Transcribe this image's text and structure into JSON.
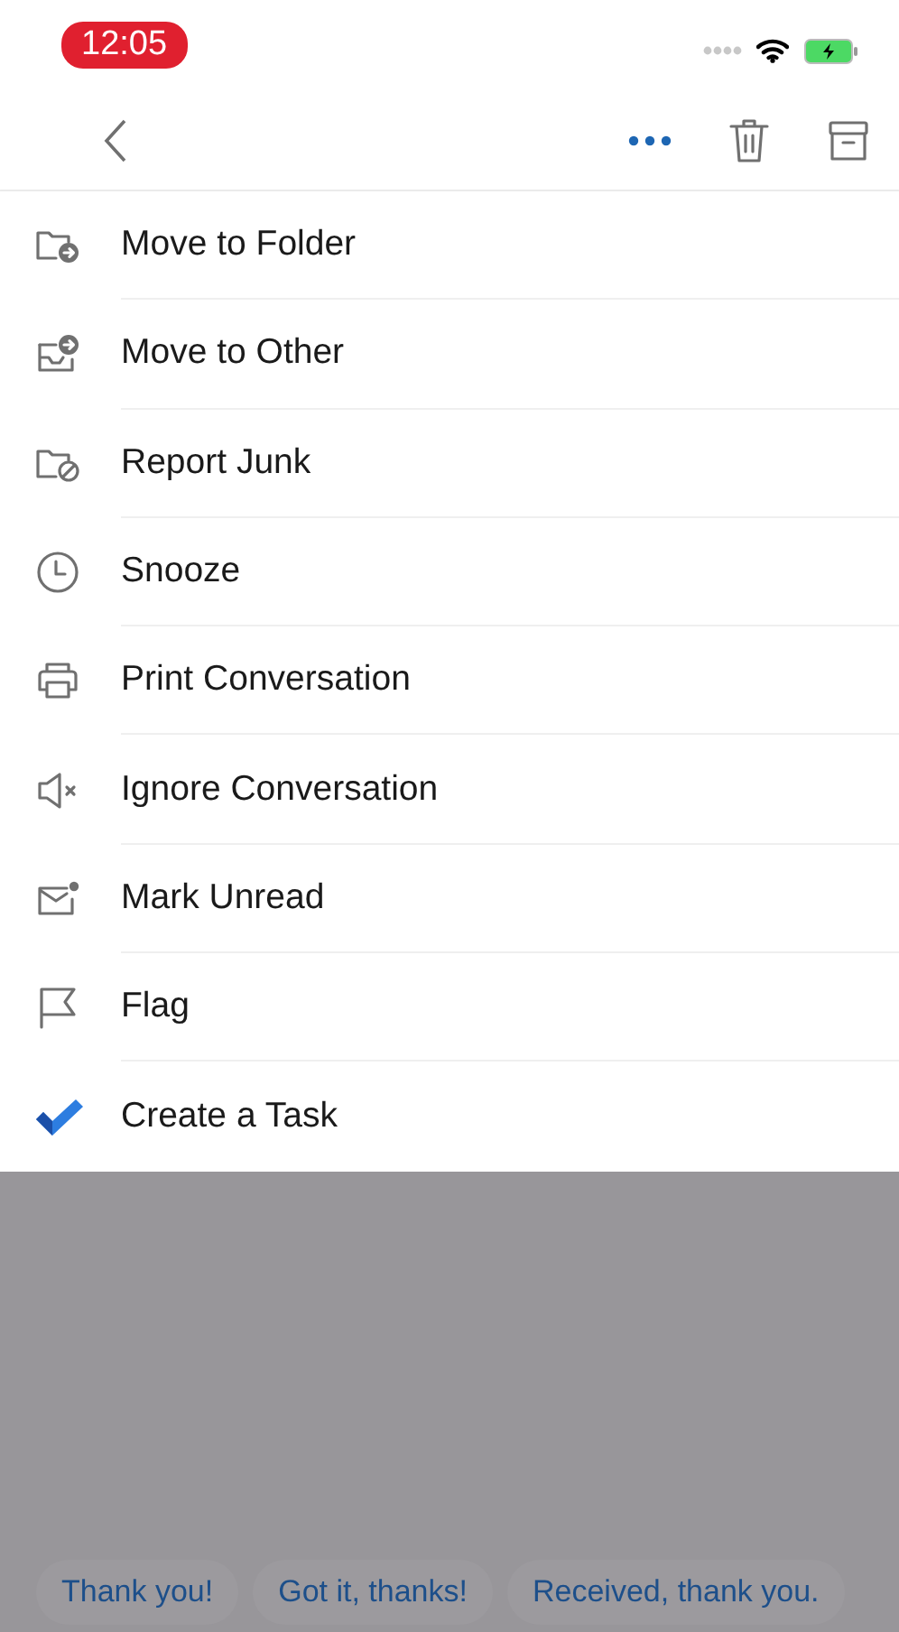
{
  "status_bar": {
    "time": "12:05"
  },
  "menu": {
    "items": [
      {
        "label": "Move to Folder"
      },
      {
        "label": "Move to Other"
      },
      {
        "label": "Report Junk"
      },
      {
        "label": "Snooze"
      },
      {
        "label": "Print Conversation"
      },
      {
        "label": "Ignore Conversation"
      },
      {
        "label": "Mark Unread"
      },
      {
        "label": "Flag"
      },
      {
        "label": "Create a Task"
      }
    ]
  },
  "quick_replies": [
    "Thank you!",
    "Got it, thanks!",
    "Received, thank you."
  ]
}
